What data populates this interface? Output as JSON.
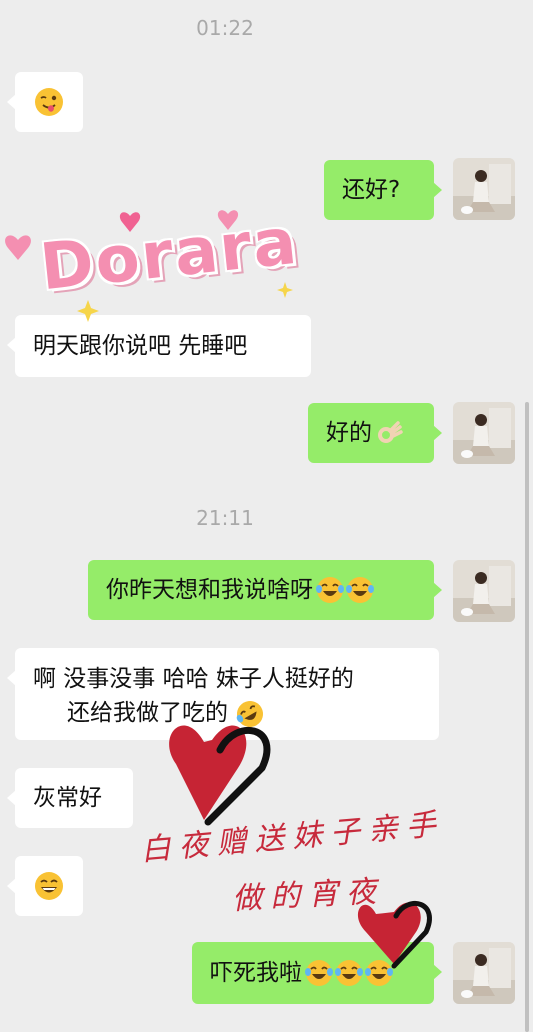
{
  "chat": {
    "times": {
      "t1": "01:22",
      "t2": "21:11"
    },
    "messages": {
      "m2": "还好?",
      "m3": "明天跟你说吧 先睡吧",
      "m4": "好的",
      "m5": "你昨天想和我说啥呀",
      "m6_line1": "啊  没事没事 哈哈  妹子人挺好的",
      "m6_line2": "还给我做了吃的",
      "m7": "灰常好",
      "m9": "吓死我啦"
    },
    "emojis": {
      "m1": "wink-tongue",
      "m4": "ok-hand",
      "m5": [
        "laugh-cry",
        "laugh-cry"
      ],
      "m6": "laugh-cry-rolling",
      "m8": "grin",
      "m9": [
        "laugh-cry",
        "laugh-cry",
        "laugh-cry"
      ]
    }
  },
  "sticker": {
    "text": "Dorara",
    "handwriting_line1": "白夜赠送妹子亲手",
    "handwriting_line2": "做的宵夜"
  },
  "colors": {
    "background": "#ededed",
    "bubble_left": "#ffffff",
    "bubble_right": "#95ec69",
    "sticker_pink": "#f48fb1",
    "heart_red": "#c62434"
  }
}
